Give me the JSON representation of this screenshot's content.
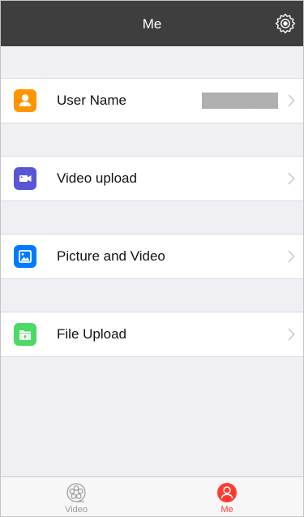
{
  "header": {
    "title": "Me",
    "settings_icon": "gear-icon"
  },
  "rows": [
    {
      "label": "User Name",
      "icon": "user-icon",
      "icon_color": "#ff9500",
      "value": ""
    },
    {
      "label": "Video upload",
      "icon": "video-camera-icon",
      "icon_color": "#5856d6"
    },
    {
      "label": "Picture and Video",
      "icon": "picture-icon",
      "icon_color": "#007aff"
    },
    {
      "label": "File Upload",
      "icon": "folder-upload-icon",
      "icon_color": "#4cd964"
    }
  ],
  "tabs": [
    {
      "label": "Video",
      "icon": "film-reel-icon",
      "color": "#9b9b9b",
      "active": false
    },
    {
      "label": "Me",
      "icon": "user-icon",
      "color": "#ff3b30",
      "active": true
    }
  ],
  "colors": {
    "navbar": "#3e3e3e",
    "background": "#efeff4",
    "chevron": "#c7c7cc"
  }
}
